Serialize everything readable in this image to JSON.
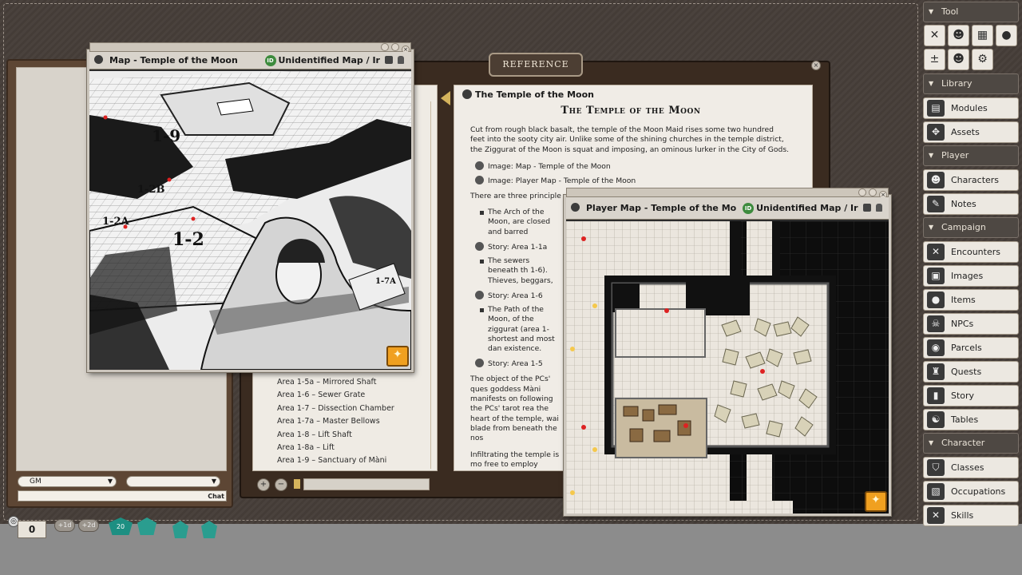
{
  "chat": {
    "identity_select": "GM",
    "mode_select": "",
    "send_label": "Chat"
  },
  "reference": {
    "title": "REFERENCE",
    "toc_items": [
      "Area 1-5a – Mirrored Shaft",
      "Area 1-6 – Sewer Grate",
      "Area 1-7 – Dissection Chamber",
      "Area 1-7a – Master Bellows",
      "Area 1-8 – Lift Shaft",
      "Area 1-8a – Lift",
      "Area 1-9 – Sanctuary of Màni"
    ],
    "doc": {
      "header": "The Temple of the Moon",
      "title": "The Temple of the Moon",
      "intro": "Cut from rough black basalt, the temple of the Moon Maid rises some two hundred feet into the sooty city air. Unlike some of the shining churches in the temple district, the Ziggurat of the Moon is squat and imposing, an ominous lurker in the City of Gods.",
      "link_image_map": "Image: Map - Temple of the Moon",
      "link_image_player_map": "Image: Player Map - Temple of the Moon",
      "entrances_intro": "There are three principle en",
      "bullet_arch": "The Arch of the Moon, are closed and barred",
      "story_1a": "Story: Area 1-1a",
      "bullet_sewers": "The sewers beneath th 1-6). Thieves, beggars,",
      "story_6": "Story: Area 1-6",
      "bullet_path": "The Path of the Moon, of the ziggurat (area 1- shortest and most dan existence.",
      "story_5": "Story: Area 1-5",
      "para_object": "The object of the PCs' ques goddess Màni manifests on following the PCs' tarot rea the heart of the temple, wai blade from beneath the nos",
      "para_infiltrating": "Infiltrating the temple is mo free to employ whatever tac all in their power to ensure However, once the alarm is bronze gates in area 1-1a th high priestess and her devo"
    }
  },
  "map_window": {
    "title": "Map - Temple of the Moon",
    "id_badge": "ID",
    "subtitle": "Unidentified Map / Ir",
    "labels": [
      "1-9",
      "1-2B",
      "1-2A",
      "1-2",
      "1-7A"
    ]
  },
  "player_map_window": {
    "title": "Player Map - Temple of the Mo",
    "id_badge": "ID",
    "subtitle": "Unidentified Map / Ir"
  },
  "sidebar": {
    "tool_header": "Tool",
    "tool_icons_row1": [
      "tools-icon",
      "characters-icon",
      "calendar-icon",
      "palette-icon"
    ],
    "tool_icons_row2": [
      "modifiers-icon",
      "effects-icon",
      "options-icon"
    ],
    "sections": [
      {
        "header": "Library",
        "items": [
          "Modules",
          "Assets"
        ]
      },
      {
        "header": "Player",
        "items": [
          "Characters",
          "Notes"
        ]
      },
      {
        "header": "Campaign",
        "items": [
          "Encounters",
          "Images",
          "Items",
          "NPCs",
          "Parcels",
          "Quests",
          "Story",
          "Tables"
        ]
      },
      {
        "header": "Character",
        "items": [
          "Classes",
          "Occupations",
          "Skills"
        ]
      }
    ]
  },
  "dice": {
    "modifier": "0",
    "plus_d": "+1d",
    "plus_2d": "+2d",
    "d20_label": "20"
  }
}
